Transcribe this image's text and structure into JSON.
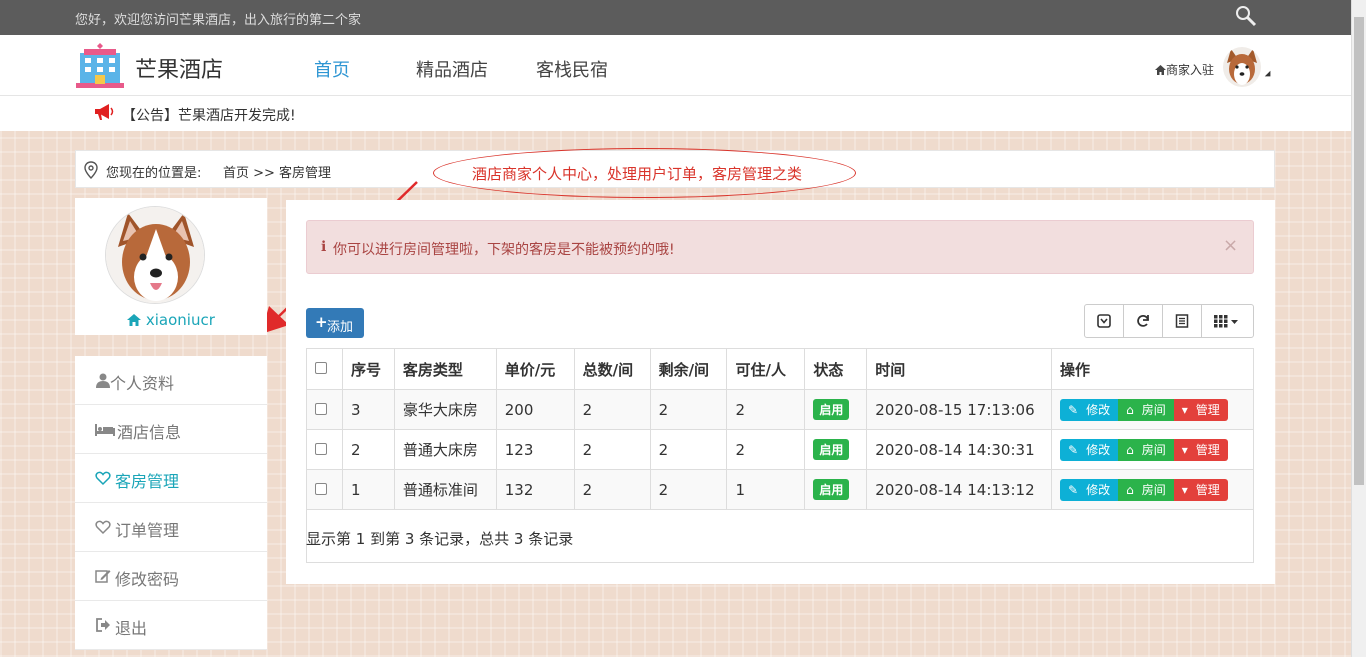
{
  "topbar": {
    "welcome": "您好，欢迎您访问芒果酒店，出入旅行的第二个家"
  },
  "navbar": {
    "brand": "芒果酒店",
    "items": [
      {
        "label": "首页",
        "active": true
      },
      {
        "label": "精品酒店",
        "active": false
      },
      {
        "label": "客栈民宿",
        "active": false
      }
    ],
    "merchant_label": "商家入驻"
  },
  "notice": {
    "text": "【公告】芒果酒店开发完成!"
  },
  "breadcrumb": {
    "label": "您现在的位置是:",
    "path": "首页 >> 客房管理"
  },
  "annotation": {
    "text": "酒店商家个人中心，处理用户订单，客房管理之类"
  },
  "profile": {
    "username": "xiaoniucr"
  },
  "sidebar": {
    "items": [
      {
        "label": "个人资料",
        "icon": "user-icon"
      },
      {
        "label": "酒店信息",
        "icon": "bed-icon"
      },
      {
        "label": "客房管理",
        "icon": "heart-icon",
        "active": true
      },
      {
        "label": "订单管理",
        "icon": "heart-icon"
      },
      {
        "label": "修改密码",
        "icon": "edit-icon"
      },
      {
        "label": "退出",
        "icon": "logout-icon"
      }
    ]
  },
  "alert": {
    "message": "你可以进行房间管理啦，下架的客房是不能被预约的哦!",
    "close": "×"
  },
  "toolbar": {
    "add_label": "添加"
  },
  "table": {
    "headers": [
      "序号",
      "客房类型",
      "单价/元",
      "总数/间",
      "剩余/间",
      "可住/人",
      "状态",
      "时间",
      "操作"
    ],
    "rows": [
      {
        "no": "3",
        "type": "豪华大床房",
        "price": "200",
        "total": "2",
        "left": "2",
        "capacity": "2",
        "status": "启用",
        "time": "2020-08-15 17:13:06"
      },
      {
        "no": "2",
        "type": "普通大床房",
        "price": "123",
        "total": "2",
        "left": "2",
        "capacity": "2",
        "status": "启用",
        "time": "2020-08-14 14:30:31"
      },
      {
        "no": "1",
        "type": "普通标准间",
        "price": "132",
        "total": "2",
        "left": "2",
        "capacity": "1",
        "status": "启用",
        "time": "2020-08-14 14:13:12"
      }
    ],
    "actions": {
      "edit": "修改",
      "room": "房间",
      "manage": "管理"
    },
    "summary": "显示第 1 到第 3 条记录，总共 3 条记录"
  },
  "colors": {
    "accent": "#2f96d3",
    "teal": "#1aa5b8",
    "success": "#2bb34b",
    "danger": "#e3403b",
    "info": "#0db0d6",
    "primary": "#337ab7"
  }
}
